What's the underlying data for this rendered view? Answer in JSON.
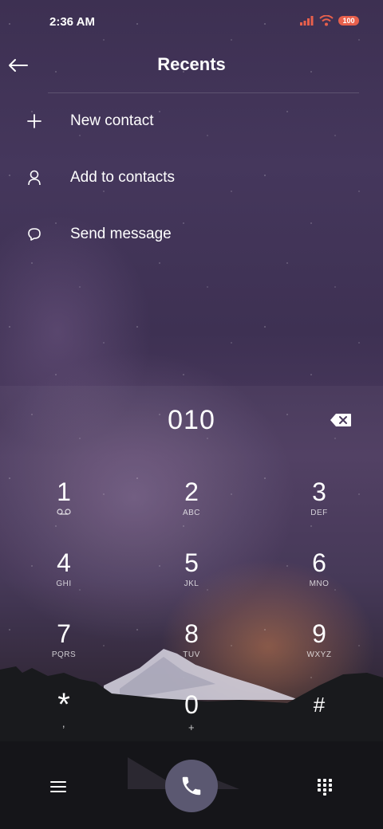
{
  "status_bar": {
    "time": "2:36 AM",
    "battery": "100",
    "icons": [
      "signal-icon",
      "wifi-icon",
      "battery-icon"
    ],
    "accent": "#e8604c"
  },
  "header": {
    "title": "Recents",
    "back_icon": "back-arrow-icon"
  },
  "menu": [
    {
      "label": "New contact",
      "icon": "plus-icon"
    },
    {
      "label": "Add to contacts",
      "icon": "person-icon"
    },
    {
      "label": "Send message",
      "icon": "chat-bubble-icon"
    }
  ],
  "dialer": {
    "number": "010",
    "backspace_icon": "backspace-icon",
    "keys": [
      {
        "digit": "1",
        "letters": ""
      },
      {
        "digit": "2",
        "letters": "ABC"
      },
      {
        "digit": "3",
        "letters": "DEF"
      },
      {
        "digit": "4",
        "letters": "GHI"
      },
      {
        "digit": "5",
        "letters": "JKL"
      },
      {
        "digit": "6",
        "letters": "MNO"
      },
      {
        "digit": "7",
        "letters": "PQRS"
      },
      {
        "digit": "8",
        "letters": "TUV"
      },
      {
        "digit": "9",
        "letters": "WXYZ"
      },
      {
        "digit": "*",
        "letters": ","
      },
      {
        "digit": "0",
        "letters": "+"
      },
      {
        "digit": "#",
        "letters": ""
      }
    ]
  },
  "bottom_bar": {
    "icons": [
      "hamburger-menu-icon",
      "phone-icon",
      "dialpad-icon"
    ],
    "call_button_color": "#5b5871"
  }
}
